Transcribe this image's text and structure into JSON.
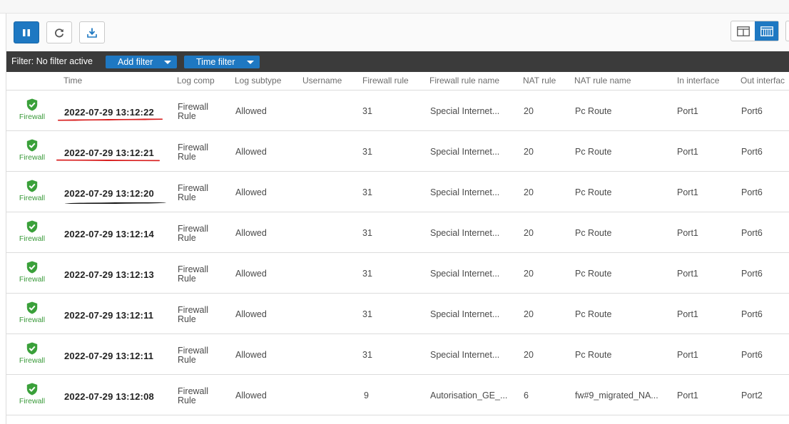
{
  "toolbar": {
    "pause_icon": "pause-icon",
    "refresh_icon": "refresh-icon",
    "download_icon": "download-icon",
    "view_icons": [
      "panel-view-icon",
      "columns-view-icon"
    ]
  },
  "filterbar": {
    "status": "Filter: No filter active",
    "add_filter": "Add filter",
    "time_filter": "Time filter"
  },
  "columns": [
    "Time",
    "Log comp",
    "Log subtype",
    "Username",
    "Firewall rule",
    "Firewall rule name",
    "NAT rule",
    "NAT rule name",
    "In interface",
    "Out interfac"
  ],
  "rows": [
    {
      "status": "Firewall",
      "time": "2022-07-29 13:12:22",
      "comp1": "Firewall",
      "comp2": "Rule",
      "subtype": "Allowed",
      "username": "",
      "fw_rule": "31",
      "fw_rule_name": "Special Internet...",
      "nat_rule": "20",
      "nat_rule_name": "Pc Route",
      "in_if": "Port1",
      "out_if": "Port6"
    },
    {
      "status": "Firewall",
      "time": "2022-07-29 13:12:21",
      "comp1": "Firewall",
      "comp2": "Rule",
      "subtype": "Allowed",
      "username": "",
      "fw_rule": "31",
      "fw_rule_name": "Special Internet...",
      "nat_rule": "20",
      "nat_rule_name": "Pc Route",
      "in_if": "Port1",
      "out_if": "Port6"
    },
    {
      "status": "Firewall",
      "time": "2022-07-29 13:12:20",
      "comp1": "Firewall",
      "comp2": "Rule",
      "subtype": "Allowed",
      "username": "",
      "fw_rule": "31",
      "fw_rule_name": "Special Internet...",
      "nat_rule": "20",
      "nat_rule_name": "Pc Route",
      "in_if": "Port1",
      "out_if": "Port6"
    },
    {
      "status": "Firewall",
      "time": "2022-07-29 13:12:14",
      "comp1": "Firewall",
      "comp2": "Rule",
      "subtype": "Allowed",
      "username": "",
      "fw_rule": "31",
      "fw_rule_name": "Special Internet...",
      "nat_rule": "20",
      "nat_rule_name": "Pc Route",
      "in_if": "Port1",
      "out_if": "Port6"
    },
    {
      "status": "Firewall",
      "time": "2022-07-29 13:12:13",
      "comp1": "Firewall",
      "comp2": "Rule",
      "subtype": "Allowed",
      "username": "",
      "fw_rule": "31",
      "fw_rule_name": "Special Internet...",
      "nat_rule": "20",
      "nat_rule_name": "Pc Route",
      "in_if": "Port1",
      "out_if": "Port6"
    },
    {
      "status": "Firewall",
      "time": "2022-07-29 13:12:11",
      "comp1": "Firewall",
      "comp2": "Rule",
      "subtype": "Allowed",
      "username": "",
      "fw_rule": "31",
      "fw_rule_name": "Special Internet...",
      "nat_rule": "20",
      "nat_rule_name": "Pc Route",
      "in_if": "Port1",
      "out_if": "Port6"
    },
    {
      "status": "Firewall",
      "time": "2022-07-29 13:12:11",
      "comp1": "Firewall",
      "comp2": "Rule",
      "subtype": "Allowed",
      "username": "",
      "fw_rule": "31",
      "fw_rule_name": "Special Internet...",
      "nat_rule": "20",
      "nat_rule_name": "Pc Route",
      "in_if": "Port1",
      "out_if": "Port6"
    },
    {
      "status": "Firewall",
      "time": "2022-07-29 13:12:08",
      "comp1": "Firewall",
      "comp2": "Rule",
      "subtype": "Allowed",
      "username": "",
      "fw_rule": "9",
      "fw_rule_name": "Autorisation_GE_...",
      "nat_rule": "6",
      "nat_rule_name": "fw#9_migrated_NA...",
      "in_if": "Port1",
      "out_if": "Port2"
    }
  ],
  "colors": {
    "accent": "#1e78c2",
    "filterbar_bg": "#3b3b3b",
    "status_green": "#3a9a3a",
    "annotation_red": "#d81f1f",
    "annotation_black": "#111111"
  }
}
